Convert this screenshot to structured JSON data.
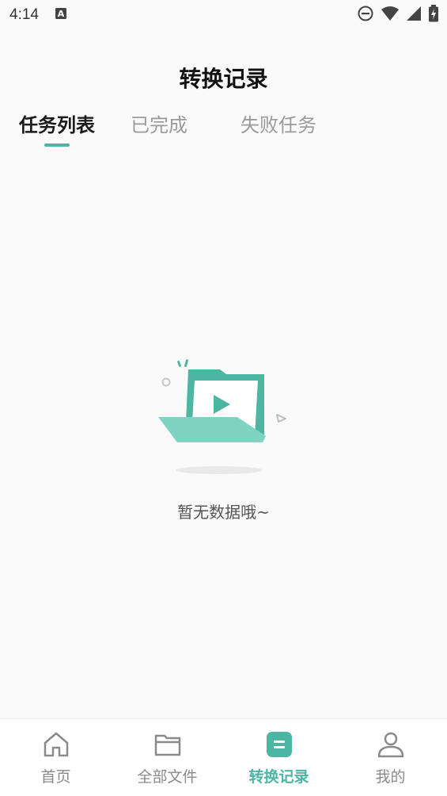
{
  "status_bar": {
    "time": "4:14",
    "icons": [
      "notification-a-icon",
      "dnd-icon",
      "wifi-icon",
      "signal-icon",
      "battery-charging-icon"
    ]
  },
  "header": {
    "title": "转换记录"
  },
  "tabs": [
    {
      "label": "任务列表",
      "active": true
    },
    {
      "label": "已完成",
      "active": false
    },
    {
      "label": "失败任务",
      "active": false
    }
  ],
  "empty_state": {
    "icon": "empty-folder-video-icon",
    "message": "暂无数据哦~"
  },
  "bottom_nav": {
    "items": [
      {
        "label": "首页",
        "icon": "home-icon",
        "active": false
      },
      {
        "label": "全部文件",
        "icon": "folder-icon",
        "active": false
      },
      {
        "label": "转换记录",
        "icon": "convert-record-icon",
        "active": true
      },
      {
        "label": "我的",
        "icon": "user-icon",
        "active": false
      }
    ]
  },
  "colors": {
    "accent": "#4db6a2",
    "accent_light": "#7fd3c3",
    "background": "#fafafa",
    "inactive": "#8a8a8a"
  }
}
